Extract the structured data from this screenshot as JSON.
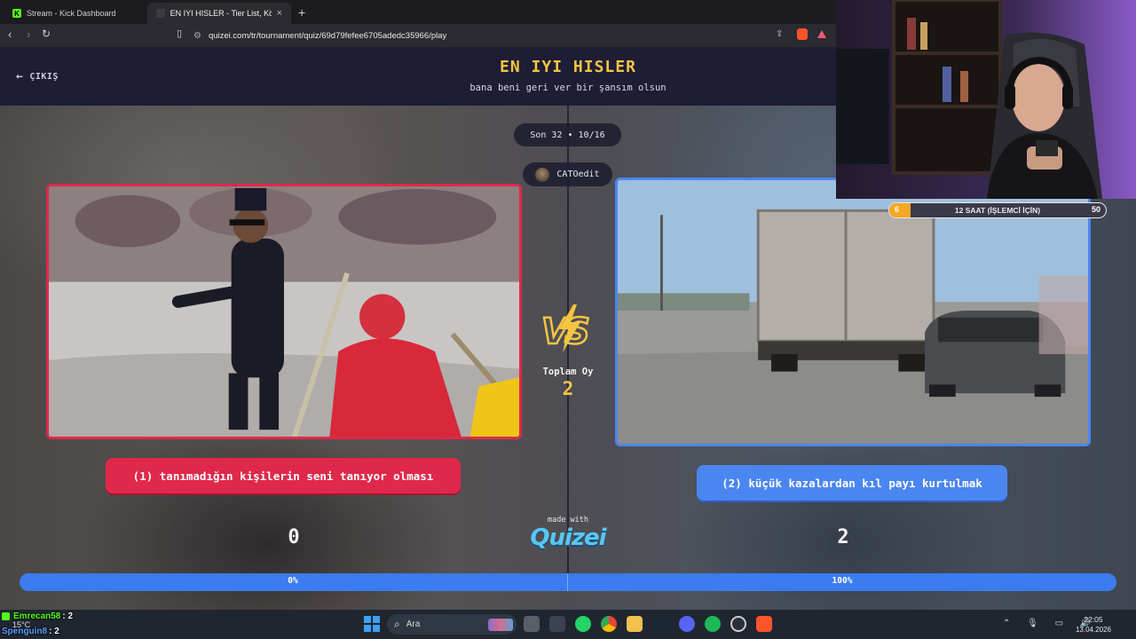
{
  "browser": {
    "tabs": [
      {
        "title": "Stream - Kick Dashboard",
        "active": false
      },
      {
        "title": "EN IYI HISLER - Tier List, Kör Sıral",
        "active": true
      }
    ],
    "url": "quizei.com/tr/tournament/quiz/69d79fefee6705adedc35966/play"
  },
  "quiz": {
    "back_label": "ÇIKIŞ",
    "title": "EN IYI HISLER",
    "subtitle": "bana beni geri ver bir şansım olsun",
    "round": "Son 32 • 10/16",
    "author": "CATOedit",
    "total_votes_label": "Toplam Oy",
    "total_votes": "2",
    "left": {
      "choice": "(1) tanımadığın kişilerin seni tanıyor olması",
      "score": "0",
      "percent_label": "0%",
      "percent": 0
    },
    "right": {
      "choice": "(2) küçük kazalardan kıl payı kurtulmak",
      "score": "2",
      "percent_label": "100%",
      "percent": 100
    },
    "made_with": "made with",
    "brand": "QUIZEI",
    "colors": {
      "left": "#e0284a",
      "right": "#4a86f0",
      "accent": "#f4c542",
      "header": "#1d1d35"
    }
  },
  "goal_widget": {
    "min": "6",
    "label": "12 SAAT (İŞLEMCİ İÇİN)",
    "max": "50",
    "fill_fraction": 0.06
  },
  "chat": [
    {
      "user": "Emrecan58",
      "message": ": 2",
      "color": "#53fc18"
    },
    {
      "user": "Spenguin8",
      "message": ": 2",
      "color": "#5aa0ff"
    }
  ],
  "taskbar": {
    "weather": "15°C",
    "search_placeholder": "Ara",
    "time": "22:05",
    "date": "13.04.2026"
  }
}
